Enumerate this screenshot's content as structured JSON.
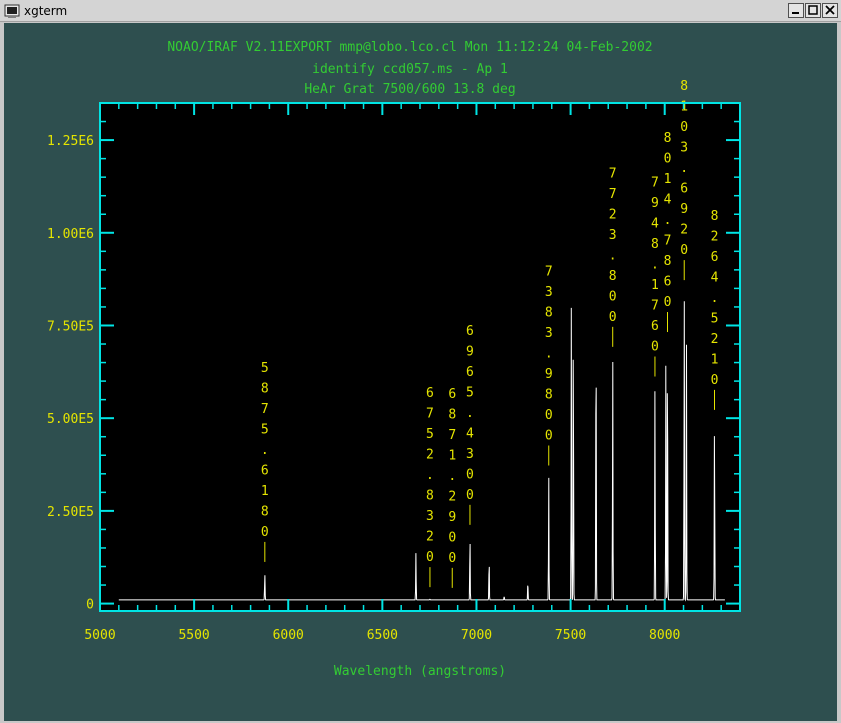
{
  "window": {
    "title": "xgterm",
    "minimize_icon": "minimize-icon",
    "maximize_icon": "maximize-icon",
    "close_icon": "close-icon"
  },
  "colors": {
    "background": "#2e4f4f",
    "plot_bg": "#000000",
    "frame": "#00e5e5",
    "header_text": "#33cc33",
    "tick_label": "#e5e500",
    "line_label": "#e5e500",
    "spectrum": "#ffffff"
  },
  "chart_data": {
    "type": "line",
    "title": [
      "NOAO/IRAF V2.11EXPORT mmp@lobo.lco.cl Mon 11:12:24 04-Feb-2002",
      "identify ccd057.ms - Ap 1",
      "HeAr Grat 7500/600 13.8 deg"
    ],
    "xlabel": "Wavelength (angstroms)",
    "ylabel": "",
    "xlim": [
      5000,
      8400
    ],
    "ylim": [
      -20000,
      1350000
    ],
    "x_ticks": [
      5000,
      5500,
      6000,
      6500,
      7000,
      7500,
      8000
    ],
    "x_tick_labels": [
      "5000",
      "5500",
      "6000",
      "6500",
      "7000",
      "7500",
      "8000"
    ],
    "y_ticks": [
      0,
      250000,
      500000,
      750000,
      1000000,
      1250000
    ],
    "y_tick_labels": [
      "0",
      "2.50E5",
      "5.00E5",
      "7.50E5",
      "1.00E6",
      "1.25E6"
    ],
    "baseline": 10000,
    "spectrum_x_range": [
      5100,
      8320
    ],
    "peaks": [
      {
        "x": 5875.6,
        "y": 80000
      },
      {
        "x": 6678.3,
        "y": 140000
      },
      {
        "x": 6752.8,
        "y": 12000
      },
      {
        "x": 6871.3,
        "y": 8000
      },
      {
        "x": 6965.4,
        "y": 180000
      },
      {
        "x": 7067.2,
        "y": 120000
      },
      {
        "x": 7147.0,
        "y": 20000
      },
      {
        "x": 7272.9,
        "y": 60000
      },
      {
        "x": 7383.9,
        "y": 340000
      },
      {
        "x": 7503.9,
        "y": 800000
      },
      {
        "x": 7514.6,
        "y": 740000
      },
      {
        "x": 7635.1,
        "y": 760000
      },
      {
        "x": 7723.8,
        "y": 660000
      },
      {
        "x": 7948.2,
        "y": 580000
      },
      {
        "x": 8006.2,
        "y": 650000
      },
      {
        "x": 8014.8,
        "y": 700000
      },
      {
        "x": 8103.7,
        "y": 840000
      },
      {
        "x": 8115.3,
        "y": 820000
      },
      {
        "x": 8264.5,
        "y": 490000
      }
    ],
    "line_labels": [
      {
        "x": 5875.618,
        "text": "5875.6180"
      },
      {
        "x": 6752.832,
        "text": "6752.8320"
      },
      {
        "x": 6871.289,
        "text": "6871.2900"
      },
      {
        "x": 6965.43,
        "text": "6965.4300"
      },
      {
        "x": 7383.98,
        "text": "7383.9800"
      },
      {
        "x": 7723.8,
        "text": "7723.800"
      },
      {
        "x": 7948.176,
        "text": "7948.1760"
      },
      {
        "x": 8014.786,
        "text": "8014.7860"
      },
      {
        "x": 8103.692,
        "text": "8103.6920"
      },
      {
        "x": 8264.521,
        "text": "8264.5210"
      }
    ]
  }
}
